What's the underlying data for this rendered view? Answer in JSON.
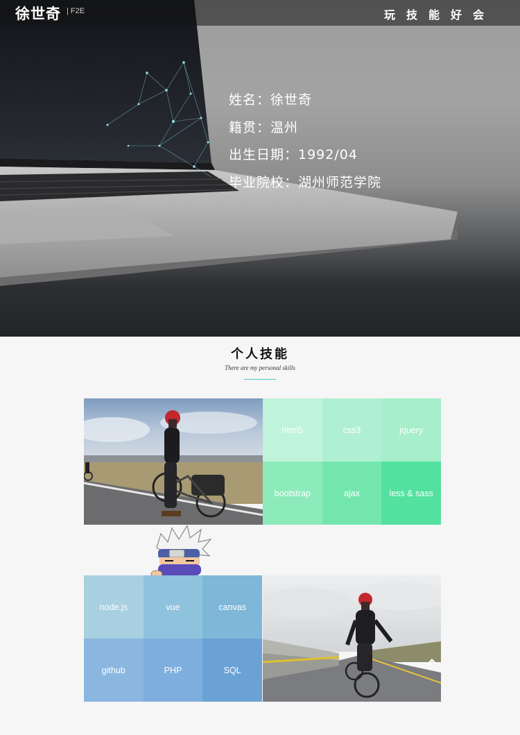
{
  "header": {
    "brand": "徐世奇",
    "brand_tag": "F2E",
    "nav_title": "玩技能好会"
  },
  "profile": {
    "name": "姓名：徐世奇",
    "hometown": "籍贯：温州",
    "birth": "出生日期：1992/04",
    "school": "毕业院校：湖州师范学院"
  },
  "skills": {
    "title": "个人技能",
    "subtitle": "There are my personal skills",
    "group1": [
      {
        "label": "html5",
        "color": "#bff3da"
      },
      {
        "label": "css3",
        "color": "#b0f0d2"
      },
      {
        "label": "jquery",
        "color": "#a7eecb"
      },
      {
        "label": "bootstrap",
        "color": "#8deabb"
      },
      {
        "label": "ajax",
        "color": "#73e6ae"
      },
      {
        "label": "less & sass",
        "color": "#52e19f"
      }
    ],
    "group2": [
      {
        "label": "node.js",
        "color": "#a8d0e0"
      },
      {
        "label": "vue",
        "color": "#8fc2dd"
      },
      {
        "label": "canvas",
        "color": "#7eb7d8"
      },
      {
        "label": "github",
        "color": "#8ab6e0"
      },
      {
        "label": "PHP",
        "color": "#7eaedd"
      },
      {
        "label": "SQL",
        "color": "#6aa2d5"
      }
    ]
  },
  "icons": {
    "mascot": "kakashi-mascot-icon",
    "photo1": "cyclist-standing-photo",
    "photo2": "cyclist-riding-photo"
  }
}
